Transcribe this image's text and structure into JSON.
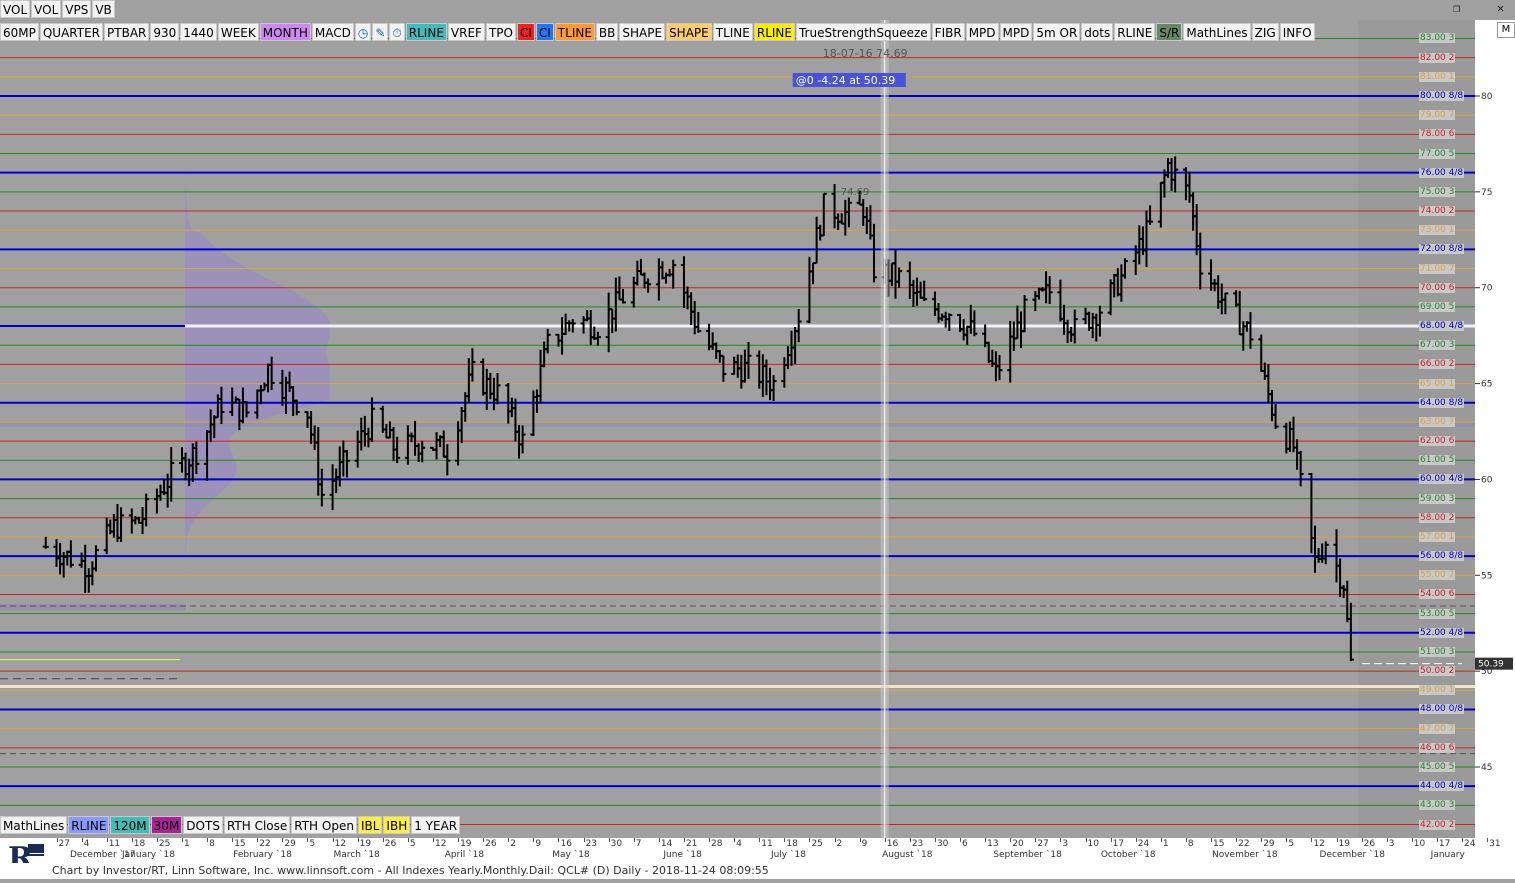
{
  "toolbar_top": [
    "VOL",
    "VOL",
    "VPS",
    "VB"
  ],
  "toolbar_main": [
    {
      "label": "60MP",
      "bg": "#f2f2f2"
    },
    {
      "label": "QUARTER",
      "bg": "#f2f2f2"
    },
    {
      "label": "PTBAR",
      "bg": "#f2f2f2"
    },
    {
      "label": "930",
      "bg": "#f2f2f2"
    },
    {
      "label": "1440",
      "bg": "#f2f2f2"
    },
    {
      "label": "WEEK",
      "bg": "#f2f2f2"
    },
    {
      "label": "MONTH",
      "bg": "#cc88ee"
    },
    {
      "label": "MACD",
      "bg": "#f2f2f2"
    },
    {
      "label": "clock-icon",
      "icon": true,
      "bg": "#f2f2f2"
    },
    {
      "label": "pencil-icon",
      "icon": true,
      "bg": "#f2f2f2"
    },
    {
      "label": "stopwatch-icon",
      "icon": true,
      "bg": "#f2f2f2"
    },
    {
      "label": "RLINE",
      "bg": "#44bbbb"
    },
    {
      "label": "VREF",
      "bg": "#f2f2f2"
    },
    {
      "label": "TPO",
      "bg": "#f2f2f2"
    },
    {
      "label": "CI",
      "bg": "#ee2222"
    },
    {
      "label": "CI",
      "bg": "#2277ee"
    },
    {
      "label": "TLINE",
      "bg": "#ff9933"
    },
    {
      "label": "BB",
      "bg": "#f2f2f2"
    },
    {
      "label": "SHAPE",
      "bg": "#f2f2f2"
    },
    {
      "label": "SHAPE",
      "bg": "#ffcc66"
    },
    {
      "label": "TLINE",
      "bg": "#f2f2f2"
    },
    {
      "label": "RLINE",
      "bg": "#ffee00"
    },
    {
      "label": "TrueStrengthSqueeze",
      "bg": "#f2f2f2"
    },
    {
      "label": "FIBR",
      "bg": "#f2f2f2"
    },
    {
      "label": "MPD",
      "bg": "#f2f2f2"
    },
    {
      "label": "MPD",
      "bg": "#f2f2f2"
    },
    {
      "label": "5m OR",
      "bg": "#f2f2f2"
    },
    {
      "label": "dots",
      "bg": "#f2f2f2"
    },
    {
      "label": "RLINE",
      "bg": "#f2f2f2"
    },
    {
      "label": "S/R",
      "bg": "#668866"
    },
    {
      "label": "MathLines",
      "bg": "#f2f2f2"
    },
    {
      "label": "ZIG",
      "bg": "#f2f2f2"
    },
    {
      "label": "INFO",
      "bg": "#f2f2f2"
    }
  ],
  "toolbar_bottom": [
    {
      "label": "MathLines",
      "bg": "#f2f2f2"
    },
    {
      "label": "RLINE",
      "bg": "#8899ff"
    },
    {
      "label": "120M",
      "bg": "#44bbbb"
    },
    {
      "label": "30M",
      "bg": "#aa2299"
    },
    {
      "label": "DOTS",
      "bg": "#f2f2f2"
    },
    {
      "label": "RTH Close",
      "bg": "#f2f2f2"
    },
    {
      "label": "RTH Open",
      "bg": "#f2f2f2"
    },
    {
      "label": "IBL",
      "bg": "#ffee44"
    },
    {
      "label": "IBH",
      "bg": "#ffee44"
    },
    {
      "label": "1 YEAR",
      "bg": "#f2f2f2"
    }
  ],
  "window_controls": [
    "restore-icon",
    "close-icon"
  ],
  "corner_label": "M",
  "footer_text": "Chart by Investor/RT, Linn Software, Inc. www.linnsoft.com - All Indexes Yearly.Monthly.Dail: QCL# (D) Daily - 2018-11-24 08:09:55",
  "cursor_info": "@0  -4.24 at 50.39",
  "cursor_date": "18-07-16 74.69",
  "high_label": "74.69",
  "last_price": "50.39",
  "colors": {
    "background": "#a0a0a0",
    "blue_level": "#0000cc",
    "red_level": "#cc2222",
    "orange_level": "#e0a040",
    "green_level": "#228822",
    "bars": "#000000",
    "profile": "#9b8fbf"
  },
  "chart_data": {
    "type": "bar",
    "instrument": "QCL#",
    "timeframe": "Daily",
    "ylim": [
      41.2,
      84.5
    ],
    "y_ticks": [
      45,
      50,
      55,
      60,
      65,
      70,
      75,
      80
    ],
    "grid": false,
    "levels": [
      {
        "price": 83.0,
        "label": "83.00 3",
        "kind": "green"
      },
      {
        "price": 82.0,
        "label": "82.00 2",
        "kind": "red"
      },
      {
        "price": 81.0,
        "label": "81.00 1",
        "kind": "orange"
      },
      {
        "price": 80.0,
        "label": "80.00 8/8",
        "kind": "blue"
      },
      {
        "price": 79.0,
        "label": "79.00 7",
        "kind": "orange"
      },
      {
        "price": 78.0,
        "label": "78.00 6",
        "kind": "red"
      },
      {
        "price": 77.0,
        "label": "77.00 5",
        "kind": "green"
      },
      {
        "price": 76.0,
        "label": "76.00 4/8",
        "kind": "blue"
      },
      {
        "price": 75.0,
        "label": "75.00 3",
        "kind": "green"
      },
      {
        "price": 74.0,
        "label": "74.00 2",
        "kind": "red"
      },
      {
        "price": 73.0,
        "label": "73.00 1",
        "kind": "orange"
      },
      {
        "price": 72.0,
        "label": "72.00 8/8",
        "kind": "blue"
      },
      {
        "price": 71.0,
        "label": "71.00 7",
        "kind": "orange"
      },
      {
        "price": 70.0,
        "label": "70.00 6",
        "kind": "red"
      },
      {
        "price": 69.0,
        "label": "69.00 5",
        "kind": "green"
      },
      {
        "price": 68.0,
        "label": "68.00 4/8",
        "kind": "blue"
      },
      {
        "price": 67.0,
        "label": "67.00 3",
        "kind": "green"
      },
      {
        "price": 66.0,
        "label": "66.00 2",
        "kind": "red"
      },
      {
        "price": 65.0,
        "label": "65.00 1",
        "kind": "orange"
      },
      {
        "price": 64.0,
        "label": "64.00 8/8",
        "kind": "blue"
      },
      {
        "price": 63.0,
        "label": "63.00 7",
        "kind": "orange"
      },
      {
        "price": 62.0,
        "label": "62.00 6",
        "kind": "red"
      },
      {
        "price": 61.0,
        "label": "61.00 5",
        "kind": "green"
      },
      {
        "price": 60.0,
        "label": "60.00 4/8",
        "kind": "blue"
      },
      {
        "price": 59.0,
        "label": "59.00 3",
        "kind": "green"
      },
      {
        "price": 58.0,
        "label": "58.00 2",
        "kind": "red"
      },
      {
        "price": 57.0,
        "label": "57.00 1",
        "kind": "orange"
      },
      {
        "price": 56.0,
        "label": "56.00 8/8",
        "kind": "blue"
      },
      {
        "price": 55.0,
        "label": "55.00 7",
        "kind": "orange"
      },
      {
        "price": 54.0,
        "label": "54.00 6",
        "kind": "red"
      },
      {
        "price": 53.0,
        "label": "53.00 5",
        "kind": "green"
      },
      {
        "price": 52.0,
        "label": "52.00 4/8",
        "kind": "blue"
      },
      {
        "price": 51.0,
        "label": "51.00 3",
        "kind": "green"
      },
      {
        "price": 50.0,
        "label": "50.00 2",
        "kind": "red"
      },
      {
        "price": 49.0,
        "label": "49.00 1",
        "kind": "orange"
      },
      {
        "price": 48.0,
        "label": "48.00 0/8",
        "kind": "blue"
      },
      {
        "price": 47.0,
        "label": "47.00 7",
        "kind": "orange"
      },
      {
        "price": 46.0,
        "label": "46.00 6",
        "kind": "red"
      },
      {
        "price": 45.0,
        "label": "45.00 5",
        "kind": "green"
      },
      {
        "price": 44.0,
        "label": "44.00 4/8",
        "kind": "blue"
      },
      {
        "price": 43.0,
        "label": "43.00 3",
        "kind": "green"
      },
      {
        "price": 42.0,
        "label": "42.00 2",
        "kind": "red"
      }
    ],
    "x_axis": {
      "start": "2017-11-24",
      "end": "2019-01-07",
      "ticks": [
        {
          "date": "2017-11-27",
          "label": "27"
        },
        {
          "date": "2017-12-04",
          "label": "4"
        },
        {
          "date": "2017-12-11",
          "label": "11"
        },
        {
          "date": "2017-12-18",
          "label": "18"
        },
        {
          "date": "2017-12-25",
          "label": "25"
        },
        {
          "date": "2018-01-01",
          "label": "1"
        },
        {
          "date": "2018-01-08",
          "label": "8"
        },
        {
          "date": "2018-01-15",
          "label": "15"
        },
        {
          "date": "2018-01-22",
          "label": "22"
        },
        {
          "date": "2018-01-29",
          "label": "29"
        },
        {
          "date": "2018-02-05",
          "label": "5"
        },
        {
          "date": "2018-02-12",
          "label": "12"
        },
        {
          "date": "2018-02-19",
          "label": "19"
        },
        {
          "date": "2018-02-26",
          "label": "26"
        },
        {
          "date": "2018-03-05",
          "label": "5"
        },
        {
          "date": "2018-03-12",
          "label": "12"
        },
        {
          "date": "2018-03-19",
          "label": "19"
        },
        {
          "date": "2018-03-26",
          "label": "26"
        },
        {
          "date": "2018-04-02",
          "label": "2"
        },
        {
          "date": "2018-04-09",
          "label": "9"
        },
        {
          "date": "2018-04-16",
          "label": "16"
        },
        {
          "date": "2018-04-23",
          "label": "23"
        },
        {
          "date": "2018-04-30",
          "label": "30"
        },
        {
          "date": "2018-05-07",
          "label": "7"
        },
        {
          "date": "2018-05-14",
          "label": "14"
        },
        {
          "date": "2018-05-21",
          "label": "21"
        },
        {
          "date": "2018-05-28",
          "label": "28"
        },
        {
          "date": "2018-06-04",
          "label": "4"
        },
        {
          "date": "2018-06-11",
          "label": "11"
        },
        {
          "date": "2018-06-18",
          "label": "18"
        },
        {
          "date": "2018-06-25",
          "label": "25"
        },
        {
          "date": "2018-07-02",
          "label": "2"
        },
        {
          "date": "2018-07-09",
          "label": "9"
        },
        {
          "date": "2018-07-16",
          "label": "16"
        },
        {
          "date": "2018-07-23",
          "label": "23"
        },
        {
          "date": "2018-07-30",
          "label": "30"
        },
        {
          "date": "2018-08-06",
          "label": "6"
        },
        {
          "date": "2018-08-13",
          "label": "13"
        },
        {
          "date": "2018-08-20",
          "label": "20"
        },
        {
          "date": "2018-08-27",
          "label": "27"
        },
        {
          "date": "2018-09-03",
          "label": "3"
        },
        {
          "date": "2018-09-10",
          "label": "10"
        },
        {
          "date": "2018-09-17",
          "label": "17"
        },
        {
          "date": "2018-09-24",
          "label": "24"
        },
        {
          "date": "2018-10-01",
          "label": "1"
        },
        {
          "date": "2018-10-08",
          "label": "8"
        },
        {
          "date": "2018-10-15",
          "label": "15"
        },
        {
          "date": "2018-10-22",
          "label": "22"
        },
        {
          "date": "2018-10-29",
          "label": "29"
        },
        {
          "date": "2018-11-05",
          "label": "5"
        },
        {
          "date": "2018-11-12",
          "label": "12"
        },
        {
          "date": "2018-11-19",
          "label": "19"
        },
        {
          "date": "2018-11-26",
          "label": "26"
        },
        {
          "date": "2018-12-03",
          "label": "3"
        },
        {
          "date": "2018-12-10",
          "label": "10"
        },
        {
          "date": "2018-12-17",
          "label": "17"
        },
        {
          "date": "2018-12-24",
          "label": "24"
        },
        {
          "date": "2018-12-31",
          "label": "31"
        },
        {
          "date": "2019-01-07",
          "label": "7"
        }
      ],
      "months": [
        {
          "date": "2017-12-01",
          "label": "December `17"
        },
        {
          "date": "2018-01-01",
          "label": "January `18"
        },
        {
          "date": "2018-02-01",
          "label": "February `18"
        },
        {
          "date": "2018-03-01",
          "label": "March `18"
        },
        {
          "date": "2018-04-01",
          "label": "April `18"
        },
        {
          "date": "2018-05-01",
          "label": "May `18"
        },
        {
          "date": "2018-06-01",
          "label": "June `18"
        },
        {
          "date": "2018-07-01",
          "label": "July `18"
        },
        {
          "date": "2018-08-01",
          "label": "August `18"
        },
        {
          "date": "2018-09-01",
          "label": "September `18"
        },
        {
          "date": "2018-10-01",
          "label": "October `18"
        },
        {
          "date": "2018-11-01",
          "label": "November `18"
        },
        {
          "date": "2018-12-01",
          "label": "December `18"
        },
        {
          "date": "2019-01-01",
          "label": "January"
        }
      ]
    },
    "anchors": [
      {
        "date": "2017-11-24",
        "price": 56.5
      },
      {
        "date": "2017-12-06",
        "price": 55.5
      },
      {
        "date": "2017-12-13",
        "price": 57.5
      },
      {
        "date": "2017-12-20",
        "price": 57.8
      },
      {
        "date": "2017-12-29",
        "price": 60.2
      },
      {
        "date": "2018-01-05",
        "price": 61.5
      },
      {
        "date": "2018-01-12",
        "price": 64.0
      },
      {
        "date": "2018-01-19",
        "price": 63.5
      },
      {
        "date": "2018-01-25",
        "price": 65.8
      },
      {
        "date": "2018-01-31",
        "price": 64.5
      },
      {
        "date": "2018-02-05",
        "price": 63.5
      },
      {
        "date": "2018-02-09",
        "price": 59.2
      },
      {
        "date": "2018-02-14",
        "price": 60.5
      },
      {
        "date": "2018-02-23",
        "price": 63.0
      },
      {
        "date": "2018-03-02",
        "price": 61.5
      },
      {
        "date": "2018-03-09",
        "price": 62.0
      },
      {
        "date": "2018-03-16",
        "price": 61.5
      },
      {
        "date": "2018-03-23",
        "price": 65.5
      },
      {
        "date": "2018-03-30",
        "price": 64.5
      },
      {
        "date": "2018-04-06",
        "price": 62.0
      },
      {
        "date": "2018-04-13",
        "price": 67.0
      },
      {
        "date": "2018-04-20",
        "price": 68.4
      },
      {
        "date": "2018-04-27",
        "price": 68.0
      },
      {
        "date": "2018-05-04",
        "price": 69.5
      },
      {
        "date": "2018-05-11",
        "price": 70.8
      },
      {
        "date": "2018-05-18",
        "price": 71.3
      },
      {
        "date": "2018-05-25",
        "price": 67.8
      },
      {
        "date": "2018-06-01",
        "price": 65.8
      },
      {
        "date": "2018-06-08",
        "price": 65.8
      },
      {
        "date": "2018-06-15",
        "price": 65.0
      },
      {
        "date": "2018-06-22",
        "price": 68.6
      },
      {
        "date": "2018-06-29",
        "price": 74.2
      },
      {
        "date": "2018-07-06",
        "price": 73.8
      },
      {
        "date": "2018-07-10",
        "price": 74.2
      },
      {
        "date": "2018-07-13",
        "price": 71.0
      },
      {
        "date": "2018-07-20",
        "price": 70.5
      },
      {
        "date": "2018-07-27",
        "price": 69.0
      },
      {
        "date": "2018-08-03",
        "price": 68.8
      },
      {
        "date": "2018-08-10",
        "price": 67.6
      },
      {
        "date": "2018-08-16",
        "price": 65.5
      },
      {
        "date": "2018-08-24",
        "price": 68.7
      },
      {
        "date": "2018-08-31",
        "price": 69.8
      },
      {
        "date": "2018-09-07",
        "price": 67.8
      },
      {
        "date": "2018-09-14",
        "price": 68.9
      },
      {
        "date": "2018-09-21",
        "price": 70.8
      },
      {
        "date": "2018-09-28",
        "price": 73.2
      },
      {
        "date": "2018-10-03",
        "price": 76.4
      },
      {
        "date": "2018-10-09",
        "price": 74.8
      },
      {
        "date": "2018-10-12",
        "price": 71.3
      },
      {
        "date": "2018-10-19",
        "price": 69.1
      },
      {
        "date": "2018-10-26",
        "price": 67.6
      },
      {
        "date": "2018-11-02",
        "price": 63.1
      },
      {
        "date": "2018-11-07",
        "price": 61.7
      },
      {
        "date": "2018-11-13",
        "price": 55.7
      },
      {
        "date": "2018-11-16",
        "price": 56.8
      },
      {
        "date": "2018-11-21",
        "price": 54.6
      },
      {
        "date": "2018-11-23",
        "price": 50.4
      }
    ],
    "last_price": 50.39,
    "crosshair_date": "2018-07-16"
  }
}
